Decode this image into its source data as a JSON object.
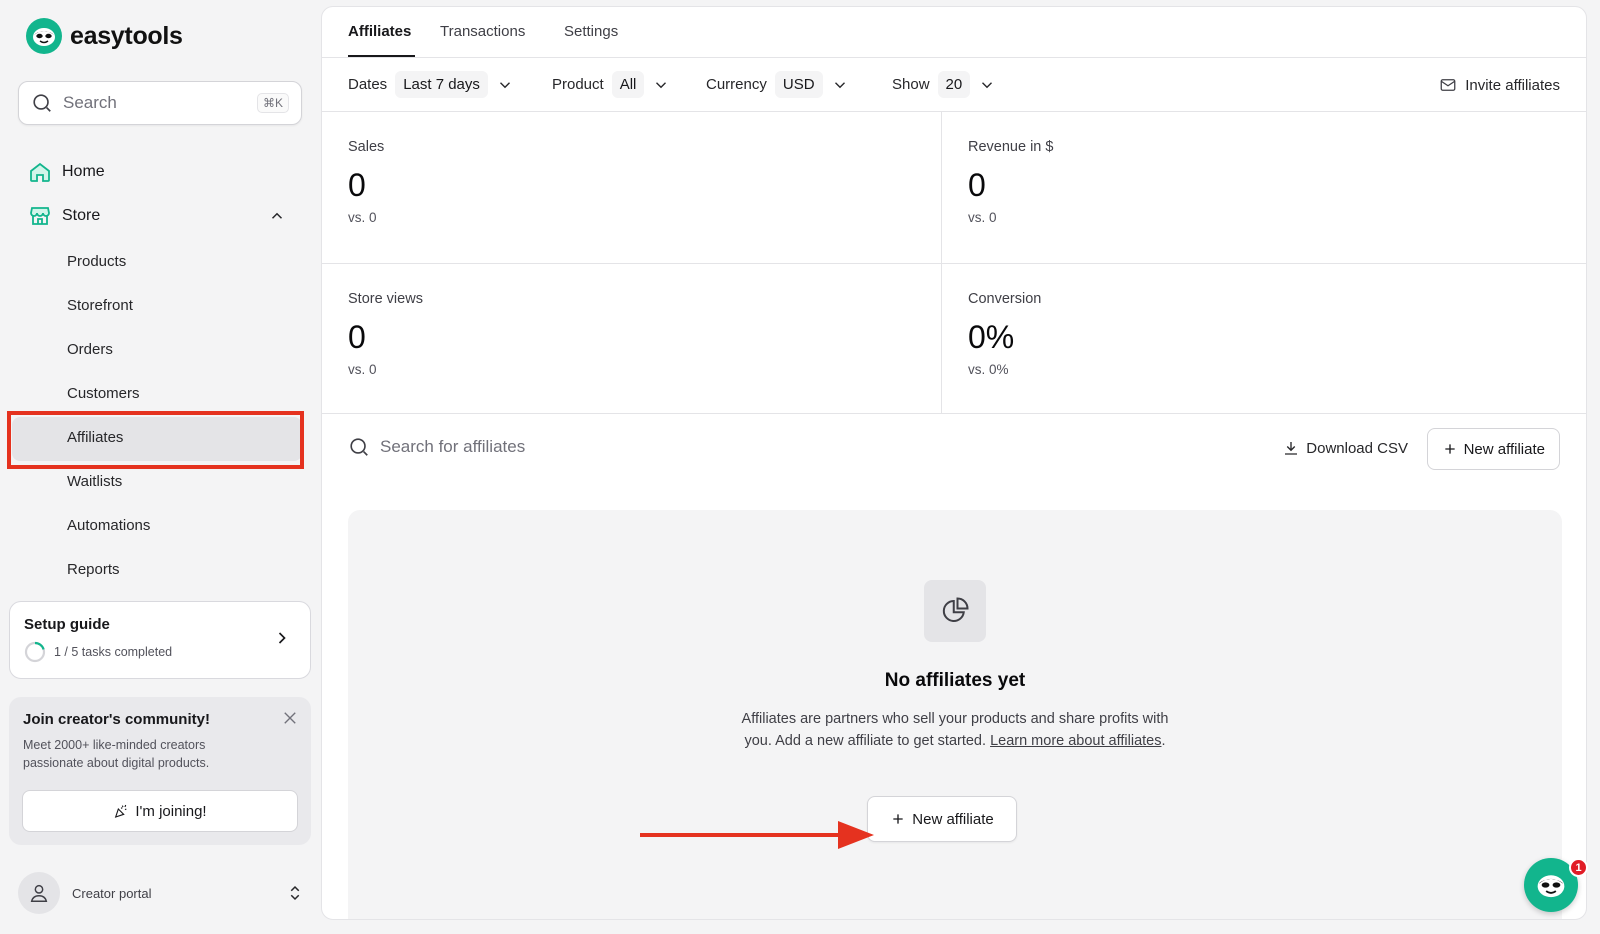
{
  "brand": {
    "name": "easytools",
    "accent": "#12b58d"
  },
  "sidebar": {
    "search_placeholder": "Search",
    "search_shortcut": "⌘K",
    "home_label": "Home",
    "store_label": "Store",
    "store_items": [
      "Products",
      "Storefront",
      "Orders",
      "Customers",
      "Affiliates",
      "Waitlists",
      "Automations",
      "Reports"
    ],
    "active_item": "Affiliates"
  },
  "setup_guide": {
    "title": "Setup guide",
    "progress": "1 / 5 tasks completed",
    "completed": 1,
    "total": 5
  },
  "community": {
    "title": "Join creator's community!",
    "description": "Meet 2000+ like-minded creators passionate about digital products.",
    "button": "I'm joining!"
  },
  "portal": {
    "label": "Creator portal"
  },
  "tabs": [
    "Affiliates",
    "Transactions",
    "Settings"
  ],
  "active_tab": "Affiliates",
  "filters": {
    "dates_label": "Dates",
    "dates_value": "Last 7 days",
    "product_label": "Product",
    "product_value": "All",
    "currency_label": "Currency",
    "currency_value": "USD",
    "show_label": "Show",
    "show_value": "20",
    "invite_label": "Invite affiliates"
  },
  "stats": [
    {
      "label": "Sales",
      "value": "0",
      "compare": "vs. 0"
    },
    {
      "label": "Revenue in $",
      "value": "0",
      "compare": "vs. 0"
    },
    {
      "label": "Store views",
      "value": "0",
      "compare": "vs. 0"
    },
    {
      "label": "Conversion",
      "value": "0%",
      "compare": "vs. 0%"
    }
  ],
  "list": {
    "search_placeholder": "Search for affiliates",
    "download_csv": "Download CSV",
    "new_affiliate": "New affiliate"
  },
  "empty_state": {
    "title": "No affiliates yet",
    "description": "Affiliates are partners who sell your products and share profits with you. Add a new affiliate to get started.",
    "link_text": "Learn more about affiliates",
    "period": ".",
    "button": "New affiliate"
  },
  "chat": {
    "badge": "1"
  },
  "annotation_color": "#e5321f"
}
